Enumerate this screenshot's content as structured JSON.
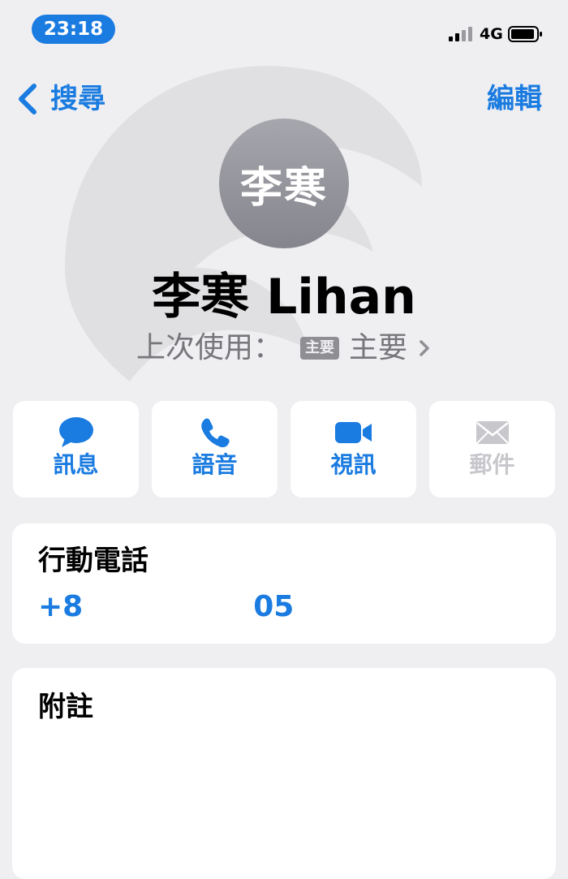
{
  "status_bar": {
    "time": "23:18",
    "network": "4G",
    "colors": {
      "time_pill": "#1a7be0"
    }
  },
  "nav": {
    "back_label": "搜尋",
    "edit_label": "編輯"
  },
  "contact": {
    "avatar_initials": "李寒",
    "name": "李寒 Lihan",
    "last_used_label": "上次使用：",
    "line_badge": "主要",
    "line_name": "主要"
  },
  "actions": [
    {
      "label": "訊息",
      "icon": "message-bubble-icon",
      "enabled": true
    },
    {
      "label": "語音",
      "icon": "phone-icon",
      "enabled": true
    },
    {
      "label": "視訊",
      "icon": "video-camera-icon",
      "enabled": true
    },
    {
      "label": "郵件",
      "icon": "mail-envelope-icon",
      "enabled": false
    }
  ],
  "phone_card": {
    "title": "行動電話",
    "number_prefix": "+8",
    "number_suffix": "05"
  },
  "notes_card": {
    "title": "附註"
  },
  "colors": {
    "accent": "#1a7be0",
    "background": "#efeff2",
    "disabled": "#c7c7cc"
  }
}
